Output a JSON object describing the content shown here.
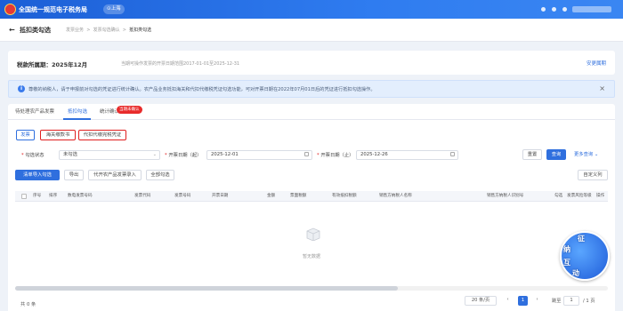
{
  "header": {
    "app_title": "全国统一规范电子税务局",
    "region": "⊙上海"
  },
  "breadcrumb": {
    "back": "←",
    "page_title": "抵扣类勾选",
    "items": [
      "发票业务",
      "发票勾选确认",
      "抵扣类勾选"
    ]
  },
  "period": {
    "label": "税款所属期：2025年12月",
    "note": "当期可操作发票的开票日期范围2017-01-01至2025-12-31",
    "link": "安更属期"
  },
  "notice": {
    "text": "尊敬的纳税人，请于申报前对勾选的凭证进行统计确认。农产品业务抵扣海关和代扣代缴税凭证勾选功能，可对开票日期在2022年07月01日后的凭证进行抵扣勾选操作。",
    "close": "×"
  },
  "tabs": [
    {
      "label": "待处理农产品发票"
    },
    {
      "label": "抵扣勾选"
    },
    {
      "label": "统计确认"
    }
  ],
  "tab_badge": "当期未确认",
  "subtabs": {
    "invoice": "发票",
    "customs": "海关缴款书",
    "withholding": "代扣代缴完税凭证"
  },
  "filters": {
    "status_label": "勾选状态",
    "status_value": "未勾选",
    "start_label": "开票日期（起）",
    "start_value": "2025-12-01",
    "end_label": "开票日期（止）",
    "end_value": "2025-12-26",
    "reset": "重置",
    "query": "查询",
    "more": "更多查询 ⌄"
  },
  "actions": {
    "import": "清单导入勾选",
    "export": "导出",
    "agri_input": "代开农产品发票录入",
    "select_all": "全部勾选",
    "custom_cols": "自定义列"
  },
  "table": {
    "columns": [
      "序号",
      "排序",
      "数电发票号码",
      "发票代码",
      "发票号码",
      "开票日期",
      "金额",
      "票面税额",
      "有效抵扣税额",
      "销售方纳税人名称",
      "销售方纳税人识别号",
      "勾选",
      "发票风险等级",
      "操作"
    ]
  },
  "empty_text": "暂无数据",
  "pagination": {
    "total": "共 0 条",
    "page_size": "20 条/页",
    "prev": "‹",
    "current": "1",
    "next": "›",
    "jump_label": "跳至",
    "jump_value": "1",
    "page_total": "/ 1 页"
  },
  "mascot": {
    "chars": [
      "征",
      "纳",
      "互",
      "动"
    ]
  },
  "colors": {
    "primary": "#2f6fde",
    "header": "#1c5fd6",
    "highlight_red": "#e02020"
  }
}
